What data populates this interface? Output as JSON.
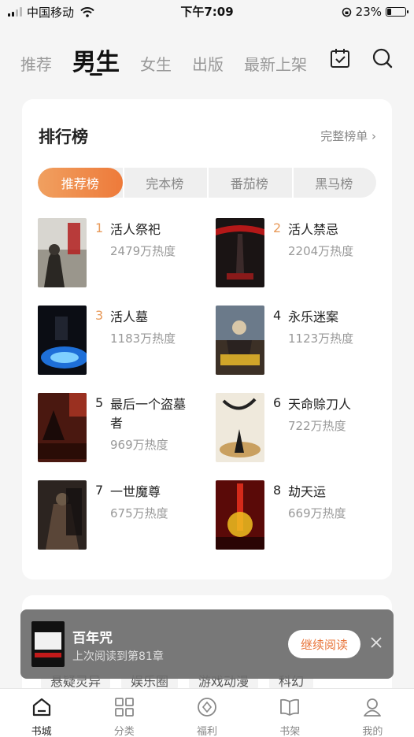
{
  "status": {
    "carrier": "中国移动",
    "time": "下午7:09",
    "battery": "23%",
    "battery_level": 0.23
  },
  "nav": {
    "tabs": [
      {
        "label": "推荐"
      },
      {
        "label": "男生"
      },
      {
        "label": "女生"
      },
      {
        "label": "出版"
      },
      {
        "label": "最新上架"
      }
    ],
    "active_tab": "男生",
    "icons": [
      "calendar-check-icon",
      "search-icon"
    ]
  },
  "ranking": {
    "title": "排行榜",
    "more": "完整榜单 ›",
    "segments": [
      "推荐榜",
      "完本榜",
      "番茄榜",
      "黑马榜"
    ],
    "active_segment": "推荐榜",
    "books": [
      {
        "rank": "1",
        "title": "活人祭祀",
        "heat": "2479万热度"
      },
      {
        "rank": "2",
        "title": "活人禁忌",
        "heat": "2204万热度"
      },
      {
        "rank": "3",
        "title": "活人墓",
        "heat": "1183万热度"
      },
      {
        "rank": "4",
        "title": "永乐迷案",
        "heat": "1123万热度"
      },
      {
        "rank": "5",
        "title": "最后一个盗墓者",
        "heat": "969万热度"
      },
      {
        "rank": "6",
        "title": "天命赊刀人",
        "heat": "722万热度"
      },
      {
        "rank": "7",
        "title": "一世魔尊",
        "heat": "675万热度"
      },
      {
        "rank": "8",
        "title": "劫天运",
        "heat": "669万热度"
      }
    ]
  },
  "categories": [
    "悬疑灵异",
    "娱乐圈",
    "游戏动漫",
    "科幻"
  ],
  "banner": {
    "title": "百年咒",
    "subtitle": "上次阅读到第81章",
    "button": "继续阅读"
  },
  "tabbar": [
    {
      "label": "书城",
      "icon": "home-icon"
    },
    {
      "label": "分类",
      "icon": "grid-icon"
    },
    {
      "label": "福利",
      "icon": "coin-icon"
    },
    {
      "label": "书架",
      "icon": "book-icon"
    },
    {
      "label": "我的",
      "icon": "user-icon"
    }
  ],
  "active_tabbar": "书城",
  "colors": {
    "accent": "#ee7a3a",
    "rank_hot": "#e89a5a"
  }
}
